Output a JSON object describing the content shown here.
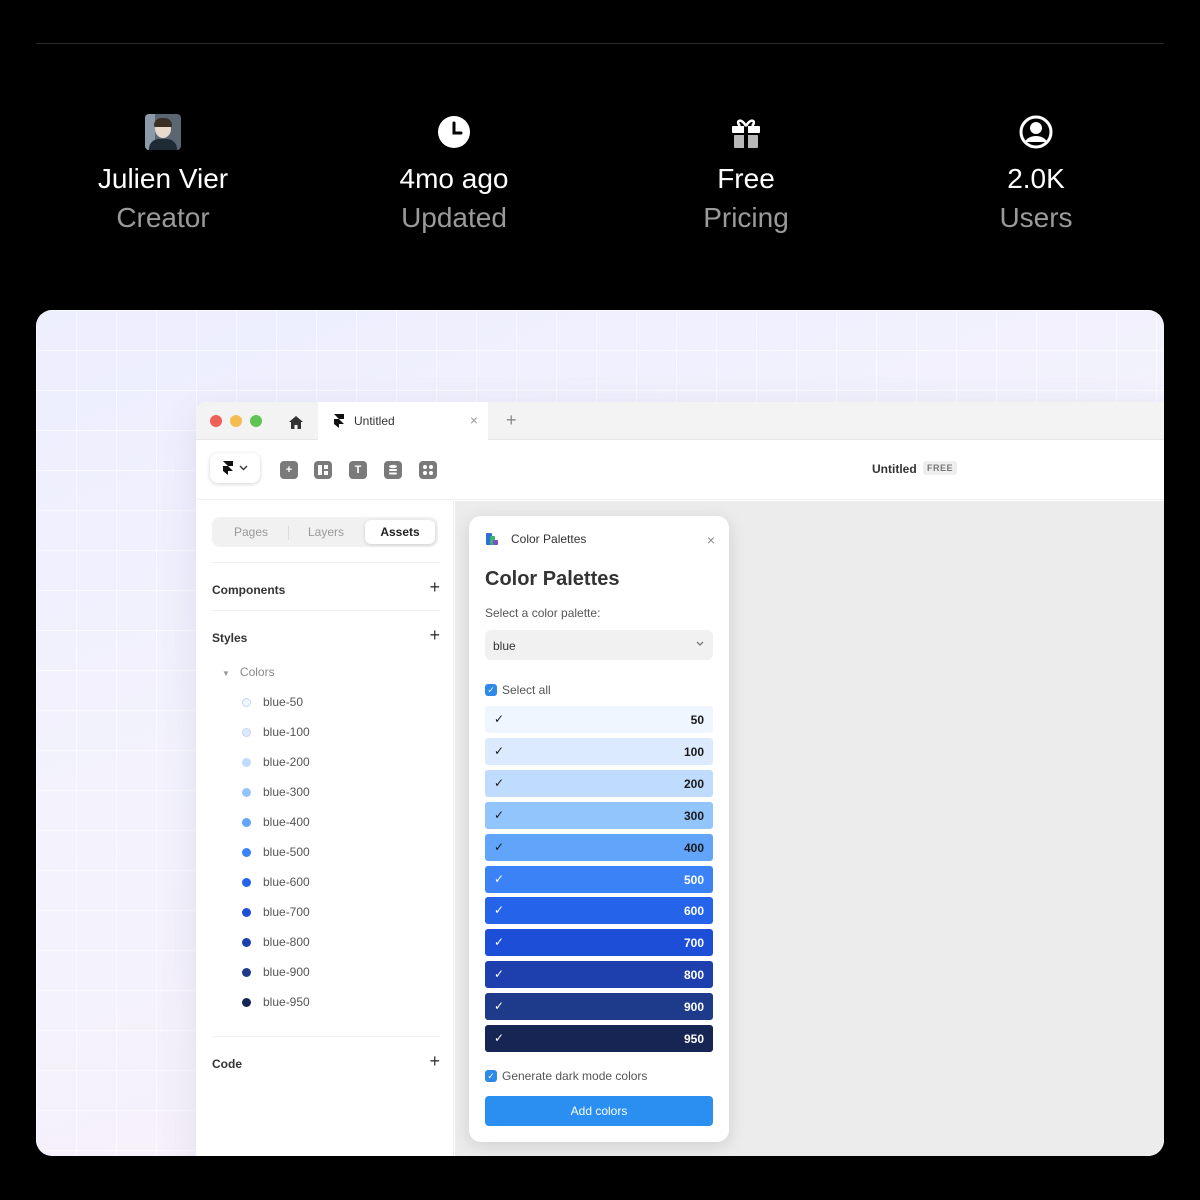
{
  "stats": [
    {
      "icon": "avatar",
      "value": "Julien Vier",
      "label": "Creator"
    },
    {
      "icon": "clock-icon",
      "value": "4mo ago",
      "label": "Updated"
    },
    {
      "icon": "gift-icon",
      "value": "Free",
      "label": "Pricing"
    },
    {
      "icon": "user-icon",
      "value": "2.0K",
      "label": "Users"
    }
  ],
  "browser": {
    "tab_title": "Untitled",
    "close_glyph": "×",
    "new_tab_glyph": "+"
  },
  "toolbar": {
    "doc_title": "Untitled",
    "plan_badge": "FREE"
  },
  "sidebar": {
    "tabs": [
      "Pages",
      "Layers",
      "Assets"
    ],
    "active_tab": "Assets",
    "sections": {
      "components": "Components",
      "styles": "Styles",
      "code": "Code"
    },
    "add_glyph": "+",
    "colors_group": "Colors",
    "colors": [
      {
        "name": "blue-50",
        "hex": "#eff6ff"
      },
      {
        "name": "blue-100",
        "hex": "#dbeafe"
      },
      {
        "name": "blue-200",
        "hex": "#bfdbfe"
      },
      {
        "name": "blue-300",
        "hex": "#93c5fd"
      },
      {
        "name": "blue-400",
        "hex": "#60a5fa"
      },
      {
        "name": "blue-500",
        "hex": "#3b82f6"
      },
      {
        "name": "blue-600",
        "hex": "#2563eb"
      },
      {
        "name": "blue-700",
        "hex": "#1d4ed8"
      },
      {
        "name": "blue-800",
        "hex": "#1e40af"
      },
      {
        "name": "blue-900",
        "hex": "#1e3a8a"
      },
      {
        "name": "blue-950",
        "hex": "#172554"
      }
    ]
  },
  "plugin": {
    "header_title": "Color Palettes",
    "title": "Color Palettes",
    "select_label": "Select a color palette:",
    "selected_palette": "blue",
    "select_all_label": "Select all",
    "check_glyph": "✓",
    "shades": [
      {
        "value": "50",
        "hex": "#eff6ff",
        "text": "#1a1a1a"
      },
      {
        "value": "100",
        "hex": "#dbeafe",
        "text": "#1a1a1a"
      },
      {
        "value": "200",
        "hex": "#bfdbfe",
        "text": "#1a1a1a"
      },
      {
        "value": "300",
        "hex": "#93c5fd",
        "text": "#1a1a1a"
      },
      {
        "value": "400",
        "hex": "#60a5fa",
        "text": "#1a1a1a"
      },
      {
        "value": "500",
        "hex": "#3b82f6",
        "text": "#ffffff"
      },
      {
        "value": "600",
        "hex": "#2563eb",
        "text": "#ffffff"
      },
      {
        "value": "700",
        "hex": "#1d4ed8",
        "text": "#ffffff"
      },
      {
        "value": "800",
        "hex": "#1e40af",
        "text": "#ffffff"
      },
      {
        "value": "900",
        "hex": "#1e3a8a",
        "text": "#ffffff"
      },
      {
        "value": "950",
        "hex": "#172554",
        "text": "#ffffff"
      }
    ],
    "dark_mode_label": "Generate dark mode colors",
    "add_button": "Add colors"
  },
  "colors": {
    "accent": "#2a8ff0",
    "traffic_red": "#ee5f57",
    "traffic_yellow": "#f5bd4f",
    "traffic_green": "#5fc454"
  }
}
